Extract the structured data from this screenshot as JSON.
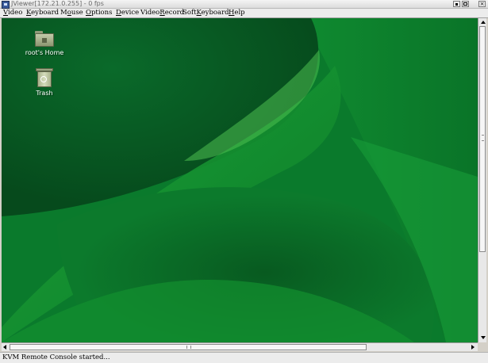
{
  "window": {
    "title": "JViewer[172.21.0.255] - 0 fps",
    "app_icon": "jviewer-app-icon",
    "controls": {
      "minimize_icon": "minimize-icon",
      "maximize_icon": "maximize-icon",
      "close_symbol": "×"
    }
  },
  "menubar": {
    "items": [
      {
        "label": "Video",
        "mnemonic_index": 0
      },
      {
        "label": "Keyboard",
        "mnemonic_index": 0
      },
      {
        "label": "Mouse",
        "mnemonic_index": 1
      },
      {
        "label": "Options",
        "mnemonic_index": 0
      },
      {
        "label": "Device",
        "mnemonic_index": 0
      },
      {
        "label": "VideoRecord",
        "mnemonic_index": 5
      },
      {
        "label": "SoftKeyboard",
        "mnemonic_index": 4
      },
      {
        "label": "Help",
        "mnemonic_index": 0
      }
    ]
  },
  "desktop": {
    "background_color": "#0b6e2c",
    "icons": [
      {
        "label": "root's Home",
        "icon": "home-folder-icon"
      },
      {
        "label": "Trash",
        "icon": "trash-icon"
      }
    ]
  },
  "statusbar": {
    "message": "KVM Remote Console started..."
  }
}
